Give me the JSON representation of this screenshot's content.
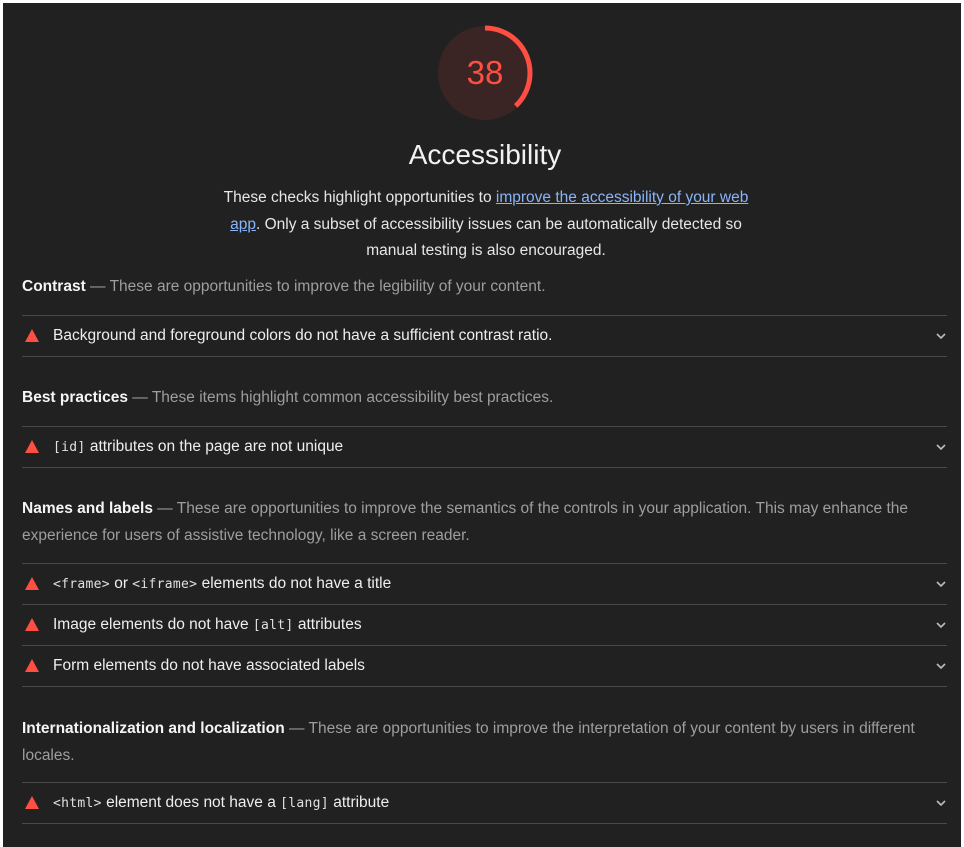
{
  "score": {
    "value": "38",
    "fraction": 0.38,
    "color": "#ff4e42",
    "track_color": "#3a2424"
  },
  "category": {
    "title": "Accessibility",
    "description_before": "These checks highlight opportunities to ",
    "description_link": "improve the accessibility of your web app",
    "description_after": ". Only a subset of accessibility issues can be automatically detected so manual testing is also encouraged."
  },
  "colors": {
    "background": "#212121",
    "fail": "#ff4e42",
    "link": "#8ab4f8"
  },
  "groups": [
    {
      "title": "Contrast",
      "separator": " — ",
      "description": "These are opportunities to improve the legibility of your content.",
      "audits": [
        {
          "icon": "warning-triangle-icon",
          "parts": [
            {
              "text": "Background and foreground colors do not have a sufficient contrast ratio."
            }
          ]
        }
      ]
    },
    {
      "title": "Best practices",
      "separator": " — ",
      "description": "These items highlight common accessibility best practices.",
      "audits": [
        {
          "icon": "warning-triangle-icon",
          "parts": [
            {
              "code": "[id]"
            },
            {
              "text": " attributes on the page are not unique"
            }
          ]
        }
      ]
    },
    {
      "title": "Names and labels",
      "separator": " — ",
      "description": "These are opportunities to improve the semantics of the controls in your application. This may enhance the experience for users of assistive technology, like a screen reader.",
      "audits": [
        {
          "icon": "warning-triangle-icon",
          "parts": [
            {
              "code": "<frame>"
            },
            {
              "text": " or "
            },
            {
              "code": "<iframe>"
            },
            {
              "text": " elements do not have a title"
            }
          ]
        },
        {
          "icon": "warning-triangle-icon",
          "parts": [
            {
              "text": "Image elements do not have "
            },
            {
              "code": "[alt]"
            },
            {
              "text": " attributes"
            }
          ]
        },
        {
          "icon": "warning-triangle-icon",
          "parts": [
            {
              "text": "Form elements do not have associated labels"
            }
          ]
        }
      ]
    },
    {
      "title": "Internationalization and localization",
      "separator": " — ",
      "description": "These are opportunities to improve the interpretation of your content by users in different locales.",
      "audits": [
        {
          "icon": "warning-triangle-icon",
          "parts": [
            {
              "code": "<html>"
            },
            {
              "text": " element does not have a "
            },
            {
              "code": "[lang]"
            },
            {
              "text": " attribute"
            }
          ]
        }
      ]
    }
  ]
}
